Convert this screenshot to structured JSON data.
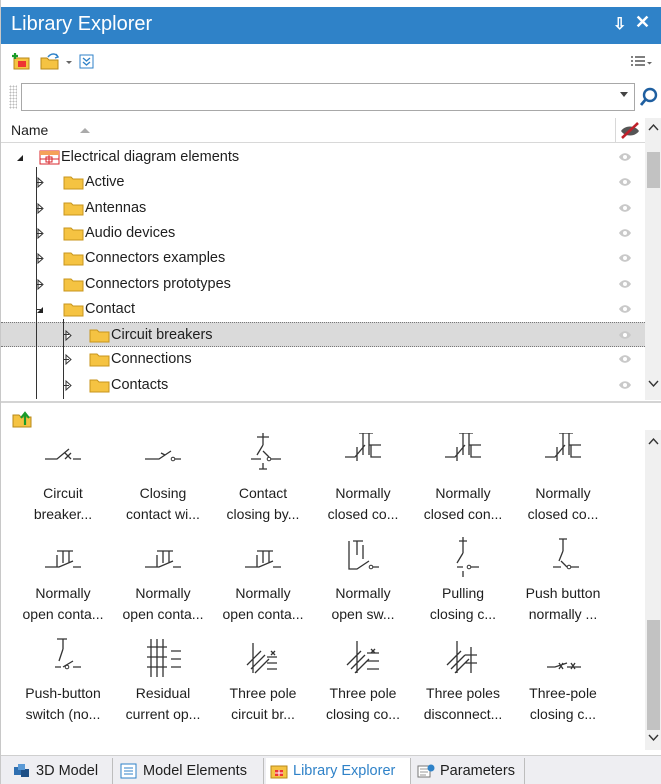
{
  "window": {
    "title": "Library Explorer",
    "pin_glyph": "⇩",
    "close_glyph": "✕"
  },
  "search": {
    "value": "",
    "placeholder": ""
  },
  "tree": {
    "column_header": "Name",
    "rows": [
      {
        "label": "Electrical diagram elements",
        "icon": "library-icon",
        "expanded": true
      },
      {
        "label": "Active",
        "icon": "folder-icon"
      },
      {
        "label": "Antennas",
        "icon": "folder-icon"
      },
      {
        "label": "Audio devices",
        "icon": "folder-icon"
      },
      {
        "label": "Connectors examples",
        "icon": "folder-icon"
      },
      {
        "label": "Connectors prototypes",
        "icon": "folder-icon"
      },
      {
        "label": "Contact",
        "icon": "folder-icon",
        "expanded": true
      },
      {
        "label": "Circuit breakers",
        "icon": "folder-icon",
        "selected": true
      },
      {
        "label": "Connections",
        "icon": "folder-icon"
      },
      {
        "label": "Contacts",
        "icon": "folder-icon"
      }
    ]
  },
  "gallery": {
    "items": [
      {
        "line1": "Circuit",
        "line2": "breaker...",
        "icon": "circuit-breaker-symbol"
      },
      {
        "line1": "Closing",
        "line2": "contact wi...",
        "icon": "closing-contact-symbol"
      },
      {
        "line1": "Contact",
        "line2": "closing by...",
        "icon": "contact-closing-symbol"
      },
      {
        "line1": "Normally",
        "line2": "closed co...",
        "icon": "normally-closed-symbol"
      },
      {
        "line1": "Normally",
        "line2": "closed con...",
        "icon": "normally-closed-symbol"
      },
      {
        "line1": "Normally",
        "line2": "closed co...",
        "icon": "normally-closed-symbol"
      },
      {
        "line1": "Normally",
        "line2": "open conta...",
        "icon": "normally-open-symbol"
      },
      {
        "line1": "Normally",
        "line2": "open conta...",
        "icon": "normally-open-symbol"
      },
      {
        "line1": "Normally",
        "line2": "open conta...",
        "icon": "normally-open-symbol"
      },
      {
        "line1": "Normally",
        "line2": "open sw...",
        "icon": "normally-open-switch-symbol"
      },
      {
        "line1": "Pulling",
        "line2": "closing c...",
        "icon": "pulling-closing-symbol"
      },
      {
        "line1": "Push button",
        "line2": "normally ...",
        "icon": "push-button-symbol"
      },
      {
        "line1": "Push-button",
        "line2": "switch (no...",
        "icon": "push-button-switch-symbol"
      },
      {
        "line1": "Residual",
        "line2": "current op...",
        "icon": "residual-current-symbol"
      },
      {
        "line1": "Three pole",
        "line2": "circuit br...",
        "icon": "three-pole-breaker-symbol"
      },
      {
        "line1": "Three pole",
        "line2": "closing co...",
        "icon": "three-pole-closing-symbol"
      },
      {
        "line1": "Three poles",
        "line2": "disconnect...",
        "icon": "three-pole-disconnector-symbol"
      },
      {
        "line1": "Three-pole",
        "line2": "closing c...",
        "icon": "three-pole-closing-alt-symbol"
      }
    ]
  },
  "tabs": [
    {
      "label": "3D Model",
      "icon": "3d-model-icon"
    },
    {
      "label": "Model Elements",
      "icon": "model-elements-icon"
    },
    {
      "label": "Library Explorer",
      "icon": "library-explorer-icon",
      "active": true
    },
    {
      "label": "Parameters",
      "icon": "parameters-icon"
    }
  ],
  "colors": {
    "accent": "#2f82c8",
    "folder": "#f5c342",
    "selection": "#dadada"
  }
}
